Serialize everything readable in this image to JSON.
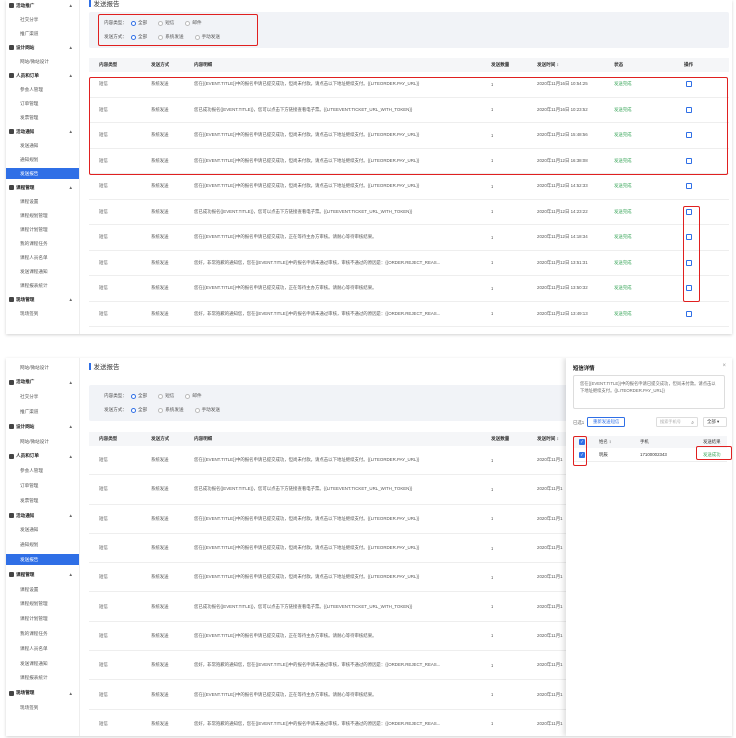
{
  "sidebar": {
    "top_items": [
      {
        "label": "活动推广",
        "group": true,
        "chevron": "▲"
      },
      {
        "label": "社交分享",
        "group": false
      },
      {
        "label": "推广渠道",
        "group": false
      },
      {
        "label": "设计网站",
        "group": true,
        "chevron": "▲"
      },
      {
        "label": "网站/微站设计",
        "group": false
      },
      {
        "label": "人员和订单",
        "group": true,
        "chevron": "▲"
      },
      {
        "label": "参会人管理",
        "group": false
      },
      {
        "label": "订单管理",
        "group": false
      },
      {
        "label": "发票管理",
        "group": false
      },
      {
        "label": "活动通知",
        "group": true,
        "chevron": "▲"
      },
      {
        "label": "发送通知",
        "group": false
      },
      {
        "label": "通知规划",
        "group": false
      },
      {
        "label": "发送报告",
        "group": false,
        "active": true
      },
      {
        "label": "课程管理",
        "group": true,
        "chevron": "▲"
      },
      {
        "label": "课程设置",
        "group": false
      },
      {
        "label": "课程规划管理",
        "group": false
      },
      {
        "label": "课程计划管理",
        "group": false
      },
      {
        "label": "我的课程任务",
        "group": false
      },
      {
        "label": "课程人员名单",
        "group": false
      },
      {
        "label": "发送课程通知",
        "group": false
      },
      {
        "label": "课程报表统计",
        "group": false
      },
      {
        "label": "现场管理",
        "group": true,
        "chevron": "▲"
      },
      {
        "label": "现场签到",
        "group": false
      }
    ],
    "bottom_items": [
      {
        "label": "网站/微站设计",
        "group": false
      },
      {
        "label": "活动推广",
        "group": true,
        "chevron": "▲"
      },
      {
        "label": "社交分享",
        "group": false
      },
      {
        "label": "推广渠道",
        "group": false
      },
      {
        "label": "设计网站",
        "group": true,
        "chevron": "▲"
      },
      {
        "label": "网站/微站设计",
        "group": false
      },
      {
        "label": "人员和订单",
        "group": true,
        "chevron": "▲"
      },
      {
        "label": "参会人管理",
        "group": false
      },
      {
        "label": "订单管理",
        "group": false
      },
      {
        "label": "发票管理",
        "group": false
      },
      {
        "label": "活动通知",
        "group": true,
        "chevron": "▲"
      },
      {
        "label": "发送通知",
        "group": false
      },
      {
        "label": "通知规划",
        "group": false
      },
      {
        "label": "发送报告",
        "group": false,
        "active": true
      },
      {
        "label": "课程管理",
        "group": true,
        "chevron": "▲"
      },
      {
        "label": "课程设置",
        "group": false
      },
      {
        "label": "课程规划管理",
        "group": false
      },
      {
        "label": "课程计划管理",
        "group": false
      },
      {
        "label": "我的课程任务",
        "group": false
      },
      {
        "label": "课程人员名单",
        "group": false
      },
      {
        "label": "发送课程通知",
        "group": false
      },
      {
        "label": "课程报表统计",
        "group": false
      },
      {
        "label": "现场管理",
        "group": true,
        "chevron": "▲"
      },
      {
        "label": "现场签到",
        "group": false
      }
    ]
  },
  "page": {
    "title": "发送报告"
  },
  "filters": {
    "type_label": "内容类型：",
    "type_options": [
      "全部",
      "短信",
      "邮件"
    ],
    "method_label": "发送方式：",
    "method_options": [
      "全部",
      "系统发送",
      "手动发送"
    ],
    "selected": "全部"
  },
  "table": {
    "headers": [
      "内容类型",
      "发送方式",
      "内容明细",
      "发送数量",
      "发送时间 ↕",
      "状态",
      "操作"
    ],
    "rows": [
      [
        "短信",
        "系统发送",
        "您在{{EVENT.TITLE}}中的报名申请已提交成功，但尚未付款。请点击以下地址继续支付。{{LITEORDER.PAY_URL}}",
        "1",
        "2020年11月16日 10:54:25",
        "发送完成"
      ],
      [
        "短信",
        "系统发送",
        "您已成功报名{{EVENT.TITLE}}，您可以点击下方链接查看电子票。{{LITEEVENT.TICKET_URL_WITH_TOKEN}}",
        "1",
        "2020年11月16日 10:23:52",
        "发送完成"
      ],
      [
        "短信",
        "系统发送",
        "您在{{EVENT.TITLE}}中的报名申请已提交成功，但尚未付款。请点击以下地址继续支付。{{LITEORDER.PAY_URL}}",
        "1",
        "2020年11月12日 15:48:56",
        "发送完成"
      ],
      [
        "短信",
        "系统发送",
        "您在{{EVENT.TITLE}}中的报名申请已提交成功，但尚未付款。请点击以下地址继续支付。{{LITEORDER.PAY_URL}}",
        "1",
        "2020年11月12日 16:38:08",
        "发送完成"
      ],
      [
        "短信",
        "系统发送",
        "您在{{EVENT.TITLE}}中的报名申请已提交成功，但尚未付款。请点击以下地址继续支付。{{LITEORDER.PAY_URL}}",
        "1",
        "2020年11月12日 14:52:33",
        "发送完成"
      ],
      [
        "短信",
        "系统发送",
        "您已成功报名{{EVENT.TITLE}}，您可以点击下方链接查看电子票。{{LITEEVENT.TICKET_URL_WITH_TOKEN}}",
        "1",
        "2020年11月12日 14:23:22",
        "发送完成"
      ],
      [
        "短信",
        "系统发送",
        "您在{{EVENT.TITLE}}中的报名申请已提交成功，正在等待主办方审核。请耐心等待审核结果。",
        "1",
        "2020年11月12日 14:18:34",
        "发送完成"
      ],
      [
        "短信",
        "系统发送",
        "您好，非常抱歉的通知您，您在{{EVENT.TITLE}}中的报名申请未通过审核，审核不通过的原因是：{{ORDER.REJECT_REAS...",
        "1",
        "2020年11月12日 13:51:31",
        "发送完成"
      ],
      [
        "短信",
        "系统发送",
        "您在{{EVENT.TITLE}}中的报名申请已提交成功，正在等待主办方审核。请耐心等待审核结果。",
        "1",
        "2020年11月12日 13:50:32",
        "发送完成"
      ],
      [
        "短信",
        "系统发送",
        "您好，非常抱歉的通知您，您在{{EVENT.TITLE}}中的报名申请未通过审核，审核不通过的原因是：{{ORDER.REJECT_REAS...",
        "1",
        "2020年11月12日 13:49:13",
        "发送完成"
      ]
    ],
    "rows_bottom": [
      [
        "短信",
        "系统发送",
        "您在{{EVENT.TITLE}}中的报名申请已提交成功，但尚未付款。请点击以下地址继续支付。{{LITEORDER.PAY_URL}}",
        "1",
        "2020年11月1"
      ],
      [
        "短信",
        "系统发送",
        "您已成功报名{{EVENT.TITLE}}，您可以点击下方链接查看电子票。{{LITEEVENT.TICKET_URL_WITH_TOKEN}}",
        "1",
        "2020年11月1"
      ],
      [
        "短信",
        "系统发送",
        "您在{{EVENT.TITLE}}中的报名申请已提交成功，但尚未付款。请点击以下地址继续支付。{{LITEORDER.PAY_URL}}",
        "1",
        "2020年11月1"
      ],
      [
        "短信",
        "系统发送",
        "您在{{EVENT.TITLE}}中的报名申请已提交成功，但尚未付款。请点击以下地址继续支付。{{LITEORDER.PAY_URL}}",
        "1",
        "2020年11月1"
      ],
      [
        "短信",
        "系统发送",
        "您在{{EVENT.TITLE}}中的报名申请已提交成功，但尚未付款。请点击以下地址继续支付。{{LITEORDER.PAY_URL}}",
        "1",
        "2020年11月1"
      ],
      [
        "短信",
        "系统发送",
        "您已成功报名{{EVENT.TITLE}}，您可以点击下方链接查看电子票。{{LITEEVENT.TICKET_URL_WITH_TOKEN}}",
        "1",
        "2020年11月1"
      ],
      [
        "短信",
        "系统发送",
        "您在{{EVENT.TITLE}}中的报名申请已提交成功，正在等待主办方审核。请耐心等待审核结果。",
        "1",
        "2020年11月1"
      ],
      [
        "短信",
        "系统发送",
        "您好，非常抱歉的通知您，您在{{EVENT.TITLE}}中的报名申请未通过审核，审核不通过的原因是：{{ORDER.REJECT_REAS...",
        "1",
        "2020年11月1"
      ],
      [
        "短信",
        "系统发送",
        "您在{{EVENT.TITLE}}中的报名申请已提交成功，正在等待主办方审核。请耐心等待审核结果。",
        "1",
        "2020年11月1"
      ],
      [
        "短信",
        "系统发送",
        "您好，非常抱歉的通知您，您在{{EVENT.TITLE}}中的报名申请未通过审核，审核不通过的原因是：{{ORDER.REJECT_REAS...",
        "1",
        "2020年11月1"
      ]
    ]
  },
  "drawer": {
    "title": "短信详情",
    "close": "×",
    "message": "您在{{EVENT.TITLE}}中的报名申请已提交成功，但尚未付款。请点击以下地址继续支付。{{LITEORDER.PAY_URL}}",
    "selected_label": "已选1",
    "resend_label": "重新发送短信",
    "search_placeholder": "搜索手机号",
    "filter_value": "全部 ▾",
    "headers": [
      "姓名 ↕",
      "手机",
      "发送结果"
    ],
    "row": {
      "name": "明辰",
      "phone": "17100002343",
      "result": "发送成功"
    }
  },
  "colors": {
    "accent": "#2f6fe6",
    "success": "#3aa65a",
    "highlight": "#e02020"
  }
}
